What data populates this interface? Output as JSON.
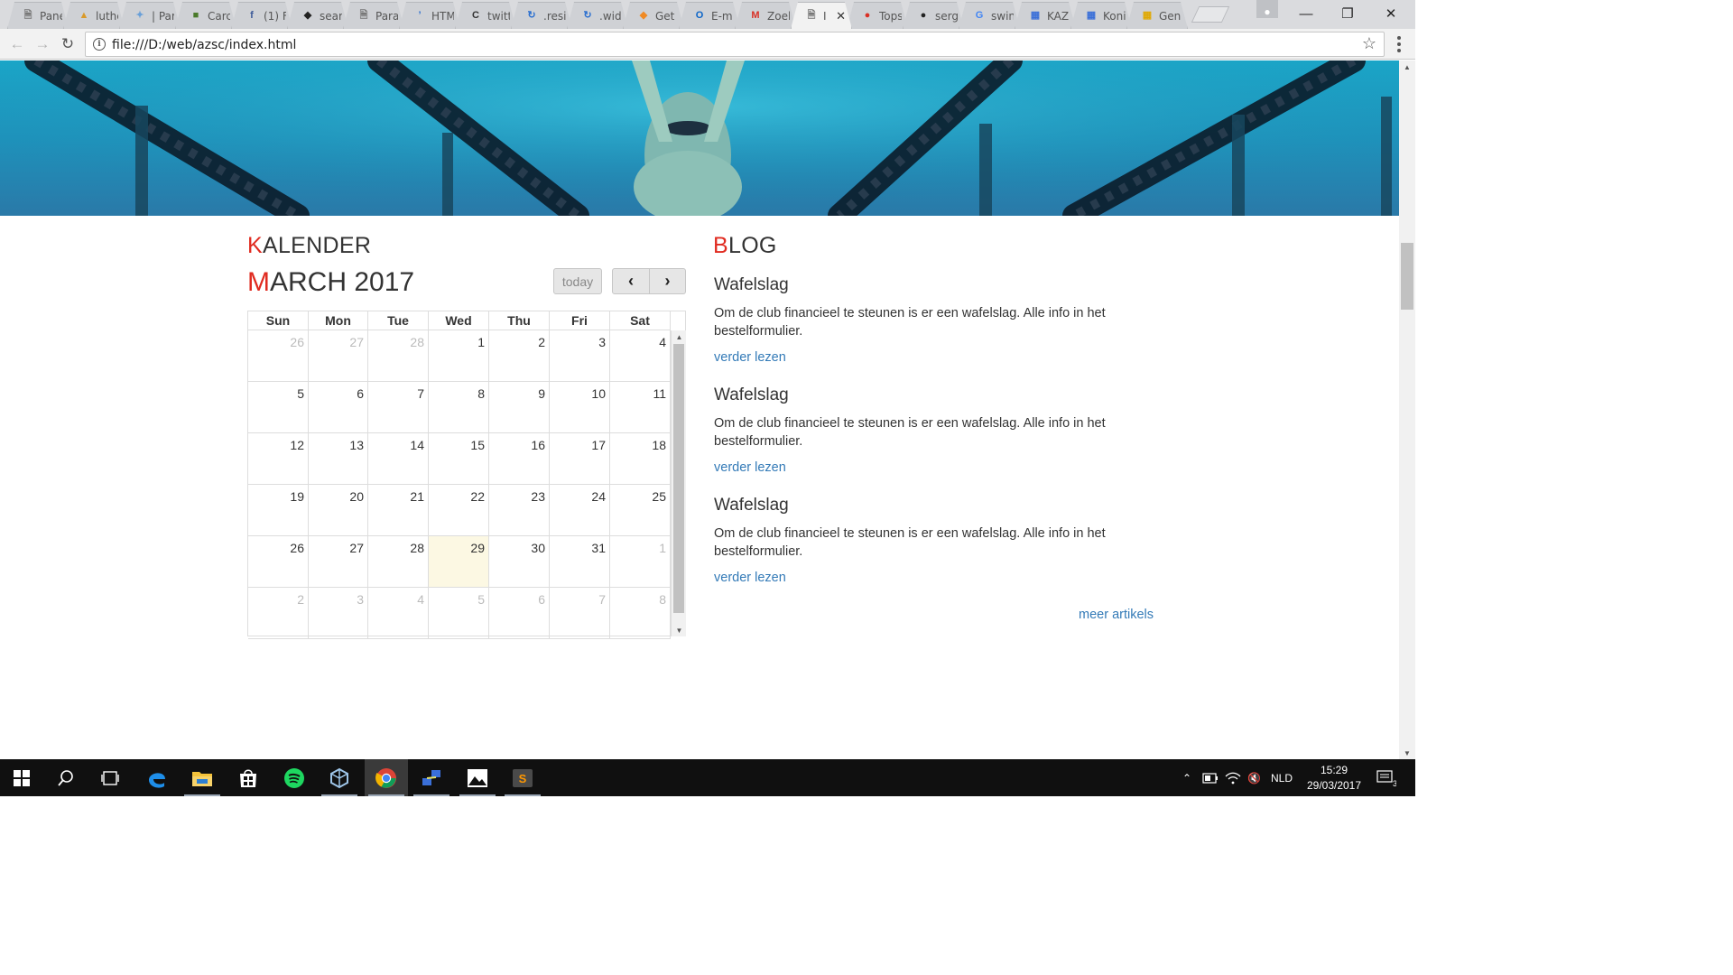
{
  "browser": {
    "tabs": [
      {
        "title": "Pane",
        "icon": "document-icon"
      },
      {
        "title": "luthe",
        "icon": "pizza-icon"
      },
      {
        "title": "| Par",
        "icon": "bookmark-icon"
      },
      {
        "title": "Carc",
        "icon": "carcassonne-icon"
      },
      {
        "title": "(1) F",
        "icon": "facebook-icon"
      },
      {
        "title": "sear",
        "icon": "codepen-icon"
      },
      {
        "title": "Para",
        "icon": "document-icon"
      },
      {
        "title": "HTM",
        "icon": "quote-icon"
      },
      {
        "title": "twitt",
        "icon": "c-icon"
      },
      {
        "title": ".resi",
        "icon": "swirl-icon"
      },
      {
        "title": ".wid",
        "icon": "swirl-icon"
      },
      {
        "title": "Get",
        "icon": "flame-icon"
      },
      {
        "title": "E-m",
        "icon": "outlook-icon"
      },
      {
        "title": "Zoel",
        "icon": "gmail-icon"
      },
      {
        "title": "I",
        "icon": "document-icon"
      },
      {
        "title": "Tops",
        "icon": "tops-icon"
      },
      {
        "title": "serg",
        "icon": "github-icon"
      },
      {
        "title": "swin",
        "icon": "google-icon"
      },
      {
        "title": "KAZ",
        "icon": "calendar-icon"
      },
      {
        "title": "Koni",
        "icon": "calendar-icon"
      },
      {
        "title": "Gen",
        "icon": "grid-icon"
      }
    ],
    "active_tab_index": 14,
    "url": "file:///D:/web/azsc/index.html"
  },
  "calendar": {
    "heading_first": "K",
    "heading_rest": "ALENDER",
    "month_first": "M",
    "month_rest": "ARCH 2017",
    "today_label": "today",
    "prev_label": "‹",
    "next_label": "›",
    "weekdays": [
      "Sun",
      "Mon",
      "Tue",
      "Wed",
      "Thu",
      "Fri",
      "Sat"
    ],
    "weeks": [
      [
        {
          "d": "26",
          "o": true
        },
        {
          "d": "27",
          "o": true
        },
        {
          "d": "28",
          "o": true
        },
        {
          "d": "1"
        },
        {
          "d": "2"
        },
        {
          "d": "3"
        },
        {
          "d": "4"
        }
      ],
      [
        {
          "d": "5"
        },
        {
          "d": "6"
        },
        {
          "d": "7"
        },
        {
          "d": "8"
        },
        {
          "d": "9"
        },
        {
          "d": "10"
        },
        {
          "d": "11"
        }
      ],
      [
        {
          "d": "12"
        },
        {
          "d": "13"
        },
        {
          "d": "14"
        },
        {
          "d": "15"
        },
        {
          "d": "16"
        },
        {
          "d": "17"
        },
        {
          "d": "18"
        }
      ],
      [
        {
          "d": "19"
        },
        {
          "d": "20"
        },
        {
          "d": "21"
        },
        {
          "d": "22"
        },
        {
          "d": "23"
        },
        {
          "d": "24"
        },
        {
          "d": "25"
        }
      ],
      [
        {
          "d": "26"
        },
        {
          "d": "27"
        },
        {
          "d": "28"
        },
        {
          "d": "29",
          "today": true
        },
        {
          "d": "30"
        },
        {
          "d": "31"
        },
        {
          "d": "1",
          "o": true
        }
      ],
      [
        {
          "d": "2",
          "o": true
        },
        {
          "d": "3",
          "o": true
        },
        {
          "d": "4",
          "o": true
        },
        {
          "d": "5",
          "o": true
        },
        {
          "d": "6",
          "o": true
        },
        {
          "d": "7",
          "o": true
        },
        {
          "d": "8",
          "o": true
        }
      ]
    ],
    "today_bg": "#fcf8e3"
  },
  "blog": {
    "heading_first": "B",
    "heading_rest": "LOG",
    "posts": [
      {
        "title": "Wafelslag",
        "body": "Om de club financieel te steunen is er een wafelslag. Alle info in het bestelformulier.",
        "link": "verder lezen"
      },
      {
        "title": "Wafelslag",
        "body": "Om de club financieel te steunen is er een wafelslag. Alle info in het bestelformulier.",
        "link": "verder lezen"
      },
      {
        "title": "Wafelslag",
        "body": "Om de club financieel te steunen is er een wafelslag. Alle info in het bestelformulier.",
        "link": "verder lezen"
      }
    ],
    "more_link": "meer artikels"
  },
  "colors": {
    "accent_red": "#e02b20",
    "link_blue": "#337ab7"
  },
  "taskbar": {
    "items": [
      "windows-start-icon",
      "search-icon",
      "task-view-icon",
      "edge-icon",
      "file-explorer-icon",
      "store-icon",
      "spotify-icon",
      "virtualbox-icon",
      "chrome-icon",
      "network-app-icon",
      "photos-icon",
      "sublime-text-icon"
    ],
    "language": "NLD",
    "time": "15:29",
    "date": "29/03/2017",
    "notification_count": "3"
  }
}
